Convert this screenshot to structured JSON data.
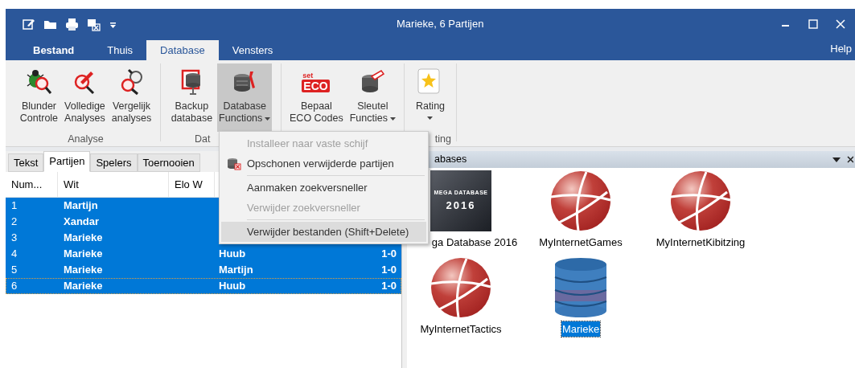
{
  "window": {
    "title": "Marieke,  6 Partijen",
    "help": "Help"
  },
  "ribbon_tabs": [
    {
      "label": "Bestand",
      "kind": "file",
      "selected": false
    },
    {
      "label": "Thuis",
      "kind": "tab",
      "selected": false
    },
    {
      "label": "Database",
      "kind": "tab",
      "selected": true
    },
    {
      "label": "Vensters",
      "kind": "tab",
      "selected": false
    }
  ],
  "ribbon_groups": [
    {
      "label": "Analyse",
      "buttons": [
        {
          "label": "Blunder\nControle",
          "dropdown": false,
          "selected": false
        },
        {
          "label": "Volledige\nAnalyses",
          "dropdown": false,
          "selected": false
        },
        {
          "label": "Vergelijk\nanalyses",
          "dropdown": false,
          "selected": false
        }
      ]
    },
    {
      "label": "Dat",
      "buttons": [
        {
          "label": "Backup\ndatabase",
          "dropdown": false,
          "selected": false
        },
        {
          "label": "Database\nFunctions",
          "dropdown": true,
          "selected": true
        }
      ]
    },
    {
      "buttons": [
        {
          "label": "Bepaal\nECO Codes",
          "eco_sup": "set",
          "eco": "ECO",
          "dropdown": false,
          "selected": false
        },
        {
          "label": "Sleutel\nFuncties",
          "dropdown": true,
          "selected": false
        }
      ]
    },
    {
      "label": "ting",
      "buttons": [
        {
          "label": "Rating",
          "dropdown": true,
          "selected": false
        }
      ]
    }
  ],
  "dropdown_menu": [
    {
      "kind": "item",
      "label": "Installeer naar vaste schijf",
      "disabled": true,
      "has_icon": false,
      "selected": false
    },
    {
      "kind": "item",
      "label": "Opschonen verwijderde partijen",
      "disabled": false,
      "has_icon": true,
      "selected": false
    },
    {
      "kind": "separator"
    },
    {
      "kind": "item",
      "label": "Aanmaken zoekversneller",
      "disabled": false,
      "has_icon": false,
      "selected": false
    },
    {
      "kind": "item",
      "label": "Verwijder zoekversneller",
      "disabled": true,
      "has_icon": false,
      "selected": false
    },
    {
      "kind": "separator"
    },
    {
      "kind": "item",
      "label": "Verwijder bestanden (Shift+Delete)",
      "disabled": false,
      "has_icon": false,
      "selected": true
    }
  ],
  "left_panel": {
    "tabs": [
      {
        "label": "Tekst",
        "selected": false
      },
      {
        "label": "Partijen",
        "selected": true
      },
      {
        "label": "Spelers",
        "selected": false
      },
      {
        "label": "Toernooien",
        "selected": false
      }
    ],
    "table": {
      "columns": [
        "Num...",
        "Wit",
        "Elo W"
      ],
      "rows": [
        {
          "num": "1",
          "white": "Martijn",
          "selected": true
        },
        {
          "num": "2",
          "white": "Xandar",
          "selected": true
        },
        {
          "num": "3",
          "white": "Marieke",
          "selected": true
        },
        {
          "num": "4",
          "white": "Marieke",
          "black": "Huub",
          "result": "1-0",
          "selected": true
        },
        {
          "num": "5",
          "white": "Marieke",
          "black": "Martijn",
          "result": "1-0",
          "selected": true
        },
        {
          "num": "6",
          "white": "Marieke",
          "black": "Huub",
          "result": "1-0",
          "selected": true
        }
      ]
    }
  },
  "databases_panel": {
    "title": "abases",
    "items": [
      {
        "label": "ga Database 2016",
        "kind": "mega",
        "cover_title": "MEGA DATABASE",
        "cover_year": "2016",
        "selected": false
      },
      {
        "label": "MyInternetGames",
        "kind": "internet",
        "selected": false
      },
      {
        "label": "MyInternetKibitzing",
        "kind": "internet",
        "selected": false
      },
      {
        "label": "MyInternetTactics",
        "kind": "internet",
        "selected": false
      },
      {
        "label": "Marieke",
        "kind": "local",
        "selected": true
      }
    ]
  }
}
